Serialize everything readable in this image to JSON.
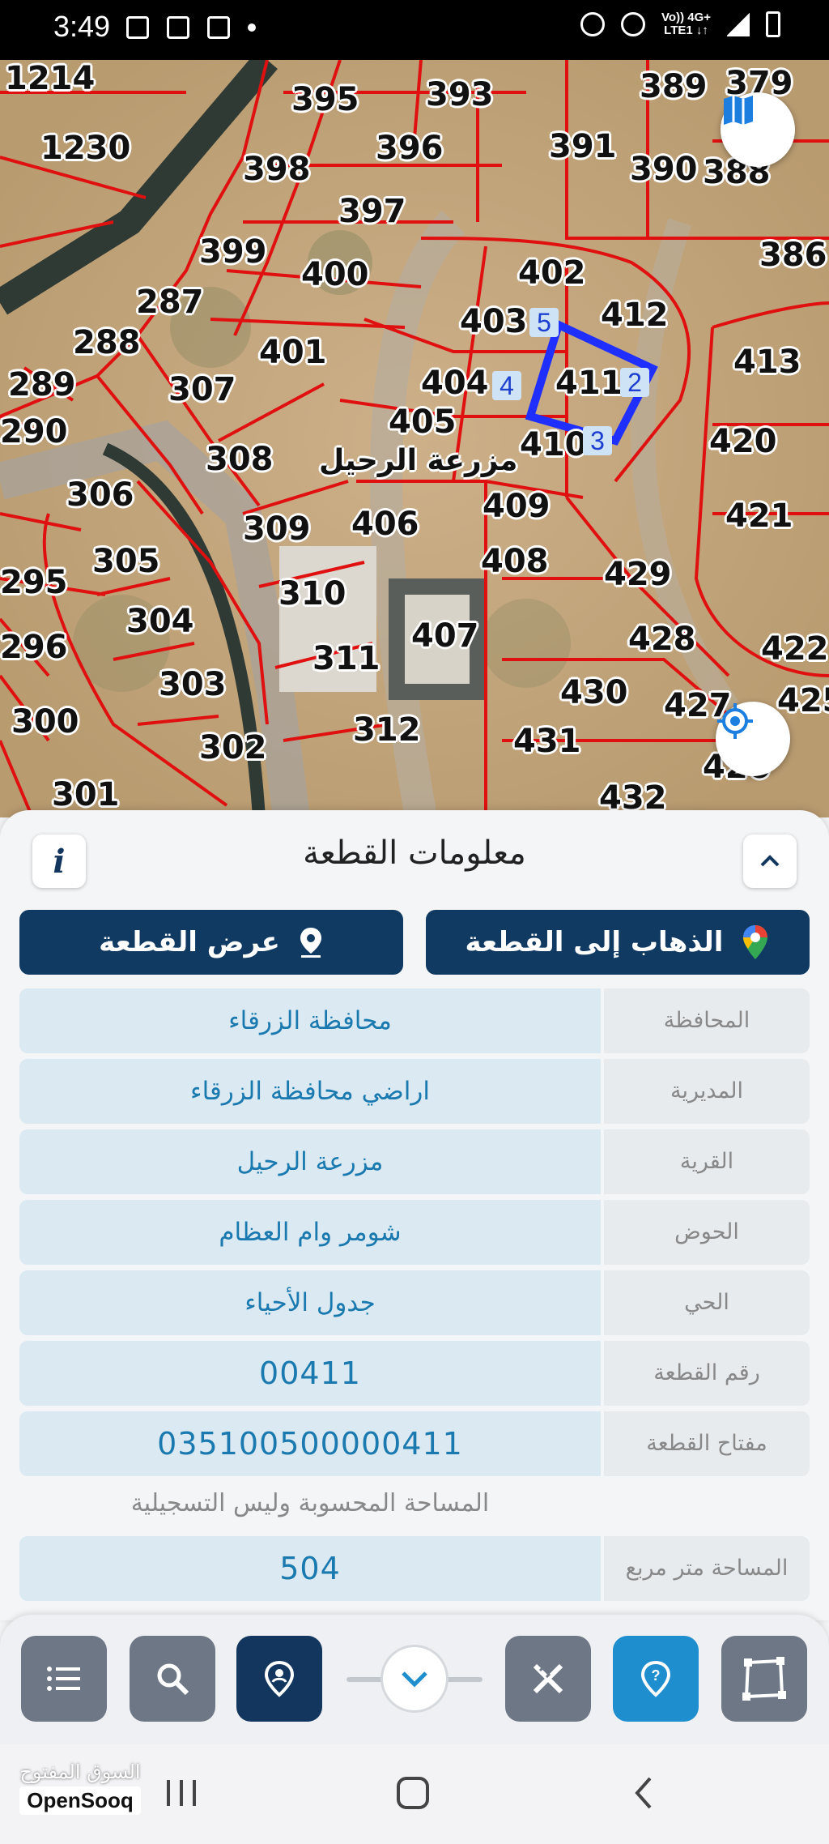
{
  "status_bar": {
    "time": "3:49",
    "network_top": "Vo)) 4G+",
    "network_bottom": "LTE1 ↓↑"
  },
  "map": {
    "place_name": "مزرعة الرحيل",
    "parcels": [
      "1214",
      "1230",
      "395",
      "393",
      "389",
      "379",
      "398",
      "396",
      "391",
      "390",
      "388",
      "397",
      "386",
      "399",
      "400",
      "402",
      "287",
      "403",
      "412",
      "288",
      "401",
      "413",
      "289",
      "307",
      "404",
      "411",
      "290",
      "405",
      "420",
      "410",
      "308",
      "306",
      "409",
      "421",
      "406",
      "309",
      "305",
      "408",
      "429",
      "295",
      "310",
      "304",
      "407",
      "428",
      "296",
      "311",
      "422",
      "303",
      "430",
      "427",
      "425",
      "300",
      "312",
      "431",
      "302",
      "301",
      "432",
      "426"
    ],
    "vertices": [
      "5",
      "4",
      "2",
      "3"
    ]
  },
  "panel": {
    "title": "معلومات القطعة",
    "goto_label": "الذهاب إلى القطعة",
    "show_label": "عرض القطعة",
    "rows": [
      {
        "label": "المحافظة",
        "value": "محافظة الزرقاء"
      },
      {
        "label": "المديرية",
        "value": "اراضي محافظة الزرقاء"
      },
      {
        "label": "القرية",
        "value": "مزرعة الرحيل"
      },
      {
        "label": "الحوض",
        "value": "شومر وام العظام"
      },
      {
        "label": "الحي",
        "value": "جدول الأحياء"
      },
      {
        "label": "رقم القطعة",
        "value": "00411"
      },
      {
        "label": "مفتاح القطعة",
        "value": "035100500000411"
      }
    ],
    "note": "المساحة المحسوبة وليس التسجيلية",
    "area": {
      "label": "المساحة متر مربع",
      "value": "504"
    }
  },
  "watermark": {
    "arabic": "السوق المفتوح",
    "english": "OpenSooq"
  },
  "colors": {
    "primary": "#113a63",
    "accent": "#1f8ecf",
    "value_bg": "#dbe9f2",
    "parcel_line": "#e01010",
    "selection": "#1f2fff"
  }
}
